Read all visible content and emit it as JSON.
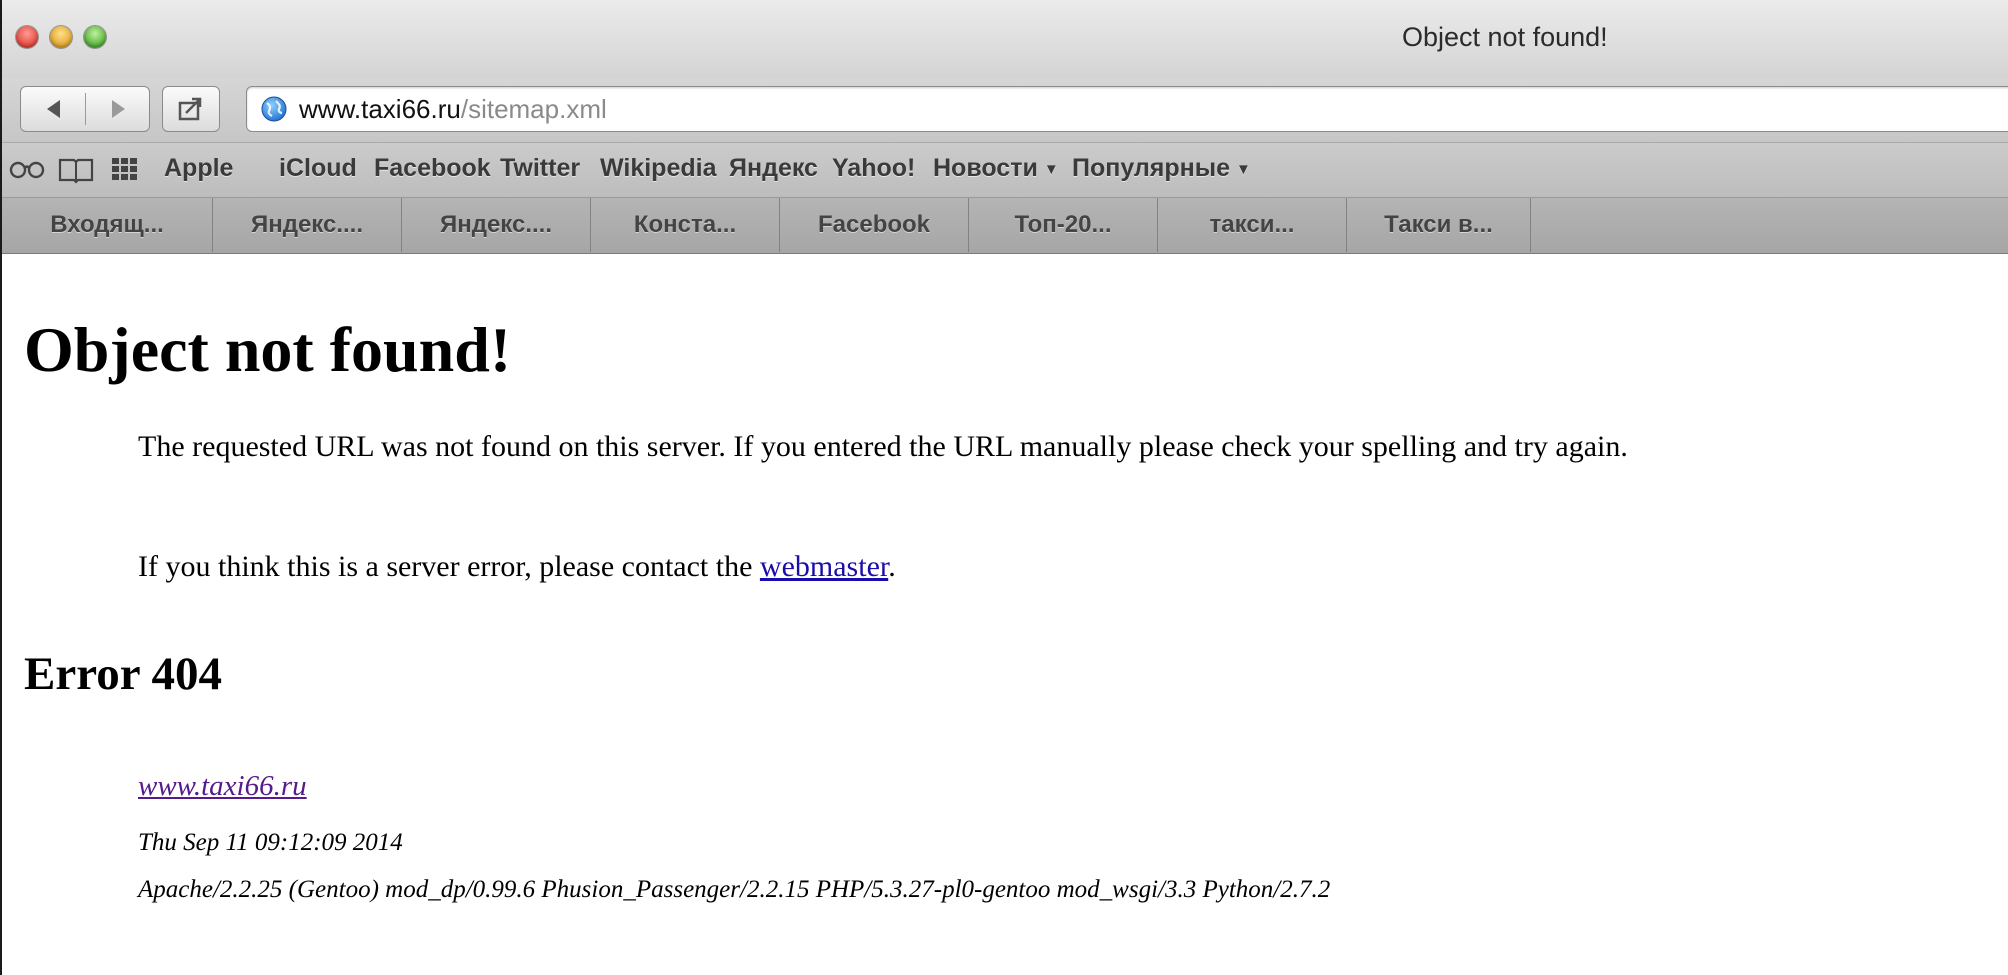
{
  "window": {
    "title": "Object not found!"
  },
  "toolbar": {
    "url_domain": "www.taxi66.ru",
    "url_path": "/sitemap.xml"
  },
  "bookmarks": {
    "items": [
      "Apple",
      "iCloud",
      "Facebook",
      "Twitter",
      "Wikipedia",
      "Яндекс",
      "Yahoo!",
      "Новости",
      "Популярные"
    ]
  },
  "tabs": [
    "Входящ...",
    "Яндекс....",
    "Яндекс....",
    "Конста...",
    "Facebook",
    "Топ-20...",
    "такси...",
    "Такси в..."
  ],
  "page": {
    "title": "Object not found!",
    "para1": "The requested URL was not found on this server. If you entered the URL manually please check your spelling and try again.",
    "para2_prefix": "If you think this is a server error, please contact the ",
    "para2_link": "webmaster",
    "para2_suffix": ".",
    "error_heading": "Error 404",
    "footer_site": "www.taxi66.ru",
    "footer_date": "Thu Sep 11 09:12:09 2014",
    "footer_server": "Apache/2.2.25 (Gentoo) mod_dp/0.99.6 Phusion_Passenger/2.2.15 PHP/5.3.27-pl0-gentoo mod_wsgi/3.3 Python/2.7.2"
  },
  "icons": {
    "window_controls": [
      "close-icon",
      "minimize-icon",
      "zoom-icon"
    ],
    "toolbar": [
      "back-icon",
      "forward-icon",
      "share-icon",
      "globe-icon"
    ],
    "bookmarks": [
      "reading-list-icon",
      "bookmarks-book-icon",
      "top-sites-grid-icon"
    ]
  }
}
